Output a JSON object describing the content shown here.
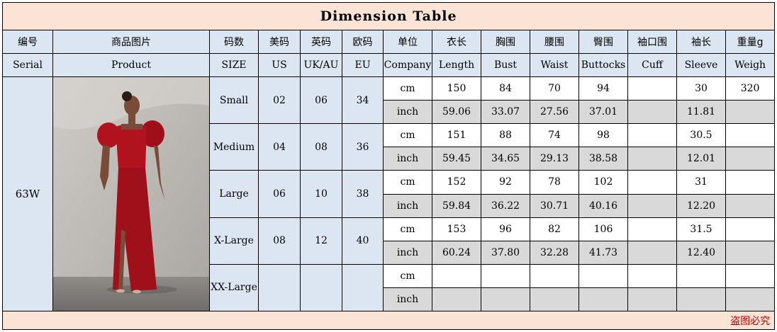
{
  "title": "Dimension Table",
  "headers_cn": [
    "编号",
    "商品图片",
    "码数",
    "美码",
    "英码",
    "欧码",
    "单位",
    "衣长",
    "胸围",
    "腰围",
    "臀围",
    "袖口围",
    "袖长",
    "重量g"
  ],
  "headers_en": [
    "Serial",
    "Product",
    "SIZE",
    "US",
    "UK/AU",
    "EU",
    "Company",
    "Length",
    "Bust",
    "Waist",
    "Buttocks",
    "Cuff",
    "Sleeve",
    "Weigh"
  ],
  "serial": "63W",
  "sizes": [
    {
      "name": "Small",
      "us": "02",
      "uk": "06",
      "eu": "34",
      "cm": {
        "unit": "cm",
        "length": "150",
        "bust": "84",
        "waist": "70",
        "buttocks": "94",
        "cuff": "",
        "sleeve": "30",
        "weight": "320"
      },
      "inch": {
        "unit": "inch",
        "length": "59.06",
        "bust": "33.07",
        "waist": "27.56",
        "buttocks": "37.01",
        "cuff": "",
        "sleeve": "11.81",
        "weight": ""
      }
    },
    {
      "name": "Medium",
      "us": "04",
      "uk": "08",
      "eu": "36",
      "cm": {
        "unit": "cm",
        "length": "151",
        "bust": "88",
        "waist": "74",
        "buttocks": "98",
        "cuff": "",
        "sleeve": "30.5",
        "weight": ""
      },
      "inch": {
        "unit": "inch",
        "length": "59.45",
        "bust": "34.65",
        "waist": "29.13",
        "buttocks": "38.58",
        "cuff": "",
        "sleeve": "12.01",
        "weight": ""
      }
    },
    {
      "name": "Large",
      "us": "06",
      "uk": "10",
      "eu": "38",
      "cm": {
        "unit": "cm",
        "length": "152",
        "bust": "92",
        "waist": "78",
        "buttocks": "102",
        "cuff": "",
        "sleeve": "31",
        "weight": ""
      },
      "inch": {
        "unit": "inch",
        "length": "59.84",
        "bust": "36.22",
        "waist": "30.71",
        "buttocks": "40.16",
        "cuff": "",
        "sleeve": "12.20",
        "weight": ""
      }
    },
    {
      "name": "X-Large",
      "us": "08",
      "uk": "12",
      "eu": "40",
      "cm": {
        "unit": "cm",
        "length": "153",
        "bust": "96",
        "waist": "82",
        "buttocks": "106",
        "cuff": "",
        "sleeve": "31.5",
        "weight": ""
      },
      "inch": {
        "unit": "inch",
        "length": "60.24",
        "bust": "37.80",
        "waist": "32.28",
        "buttocks": "41.73",
        "cuff": "",
        "sleeve": "12.40",
        "weight": ""
      }
    },
    {
      "name": "XX-Large",
      "us": "",
      "uk": "",
      "eu": "",
      "cm": {
        "unit": "cm",
        "length": "",
        "bust": "",
        "waist": "",
        "buttocks": "",
        "cuff": "",
        "sleeve": "",
        "weight": ""
      },
      "inch": {
        "unit": "inch",
        "length": "",
        "bust": "",
        "waist": "",
        "buttocks": "",
        "cuff": "",
        "sleeve": "",
        "weight": ""
      }
    }
  ],
  "footer": "盗图必究",
  "product_image": "red-dress-photo",
  "colors": {
    "title_bg": "#fbe4d5",
    "header_bg": "#dce6f2",
    "grey_cell": "#d9d9d9",
    "footer_text": "#c00000",
    "dress": "#b0121e"
  }
}
